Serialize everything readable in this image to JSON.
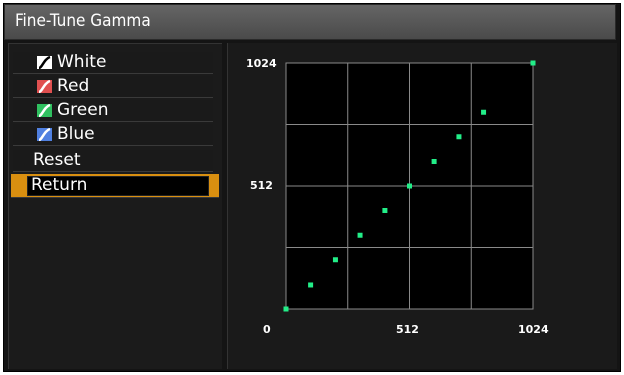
{
  "title": "Fine-Tune Gamma",
  "menu": {
    "items": [
      {
        "label": "White",
        "icon": "gamma-curve-icon",
        "color": "#ffffff"
      },
      {
        "label": "Red",
        "icon": "gamma-curve-icon",
        "color": "#e05050"
      },
      {
        "label": "Green",
        "icon": "gamma-curve-icon",
        "color": "#30c060"
      },
      {
        "label": "Blue",
        "icon": "gamma-curve-icon",
        "color": "#5080e0"
      }
    ],
    "reset_label": "Reset",
    "return_label": "Return"
  },
  "graph": {
    "y_top_label": "1024",
    "y_mid_label": "512",
    "x_zero_label": "0",
    "x_mid_label": "512",
    "x_max_label": "1024"
  },
  "chart_data": {
    "type": "scatter",
    "xlim": [
      0,
      1024
    ],
    "ylim": [
      0,
      1024
    ],
    "grid": true,
    "point_color": "#22ee88",
    "points": [
      [
        0,
        0
      ],
      [
        102,
        100
      ],
      [
        205,
        205
      ],
      [
        307,
        307
      ],
      [
        410,
        410
      ],
      [
        512,
        512
      ],
      [
        614,
        614
      ],
      [
        717,
        717
      ],
      [
        819,
        819
      ],
      [
        1024,
        1024
      ]
    ]
  }
}
